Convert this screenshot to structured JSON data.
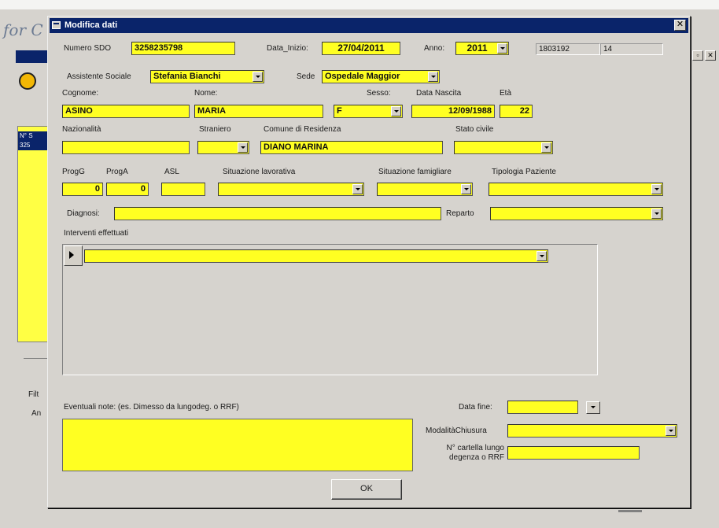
{
  "background_app": {
    "title_partial": "for C",
    "list_header_1": "N° S",
    "list_header_2": "325",
    "label_filter_partial": "Filt",
    "label_an_partial": "An"
  },
  "dialog": {
    "title": "Modifica dati",
    "close_glyph": "✕"
  },
  "fields": {
    "numero_sdo": {
      "label": "Numero SDO",
      "value": "3258235798"
    },
    "data_inizio": {
      "label": "Data_Inizio:",
      "value": "27/04/2011"
    },
    "anno": {
      "label": "Anno:",
      "value": "2011"
    },
    "readonly_1": "1803192",
    "readonly_2": "14",
    "assistente_sociale": {
      "label": "Assistente Sociale",
      "value": "Stefania Bianchi"
    },
    "sede": {
      "label": "Sede",
      "value": "Ospedale Maggior"
    },
    "cognome": {
      "label": "Cognome:",
      "value": "ASINO"
    },
    "nome": {
      "label": "Nome:",
      "value": "MARIA"
    },
    "sesso": {
      "label": "Sesso:",
      "value": "F"
    },
    "data_nascita": {
      "label": "Data Nascita",
      "value": "12/09/1988"
    },
    "eta": {
      "label": "Età",
      "value": "22"
    },
    "nazionalita": {
      "label": "Nazionalità",
      "value": ""
    },
    "straniero": {
      "label": "Straniero",
      "value": ""
    },
    "comune_residenza": {
      "label": "Comune di Residenza",
      "value": "DIANO MARINA"
    },
    "stato_civile": {
      "label": "Stato civile",
      "value": ""
    },
    "prog_g": {
      "label": "ProgG",
      "value": "0"
    },
    "prog_a": {
      "label": "ProgA",
      "value": "0"
    },
    "asl": {
      "label": "ASL",
      "value": ""
    },
    "situazione_lavorativa": {
      "label": "Situazione lavorativa",
      "value": ""
    },
    "situazione_famigliare": {
      "label": "Situazione famigliare",
      "value": ""
    },
    "tipologia_paziente": {
      "label": "Tipologia Paziente",
      "value": ""
    },
    "diagnosi": {
      "label": "Diagnosi:",
      "value": ""
    },
    "reparto": {
      "label": "Reparto",
      "value": ""
    },
    "interventi": {
      "label": "Interventi effettuati",
      "value": ""
    },
    "note": {
      "label": "Eventuali note: (es. Dimesso da lungodeg. o RRF)",
      "value": ""
    },
    "data_fine": {
      "label": "Data fine:",
      "value": ""
    },
    "modalita_chiusura": {
      "label": "ModalitàChiusura",
      "value": ""
    },
    "cartella_line1": "N° cartella lungo",
    "cartella_line2": "degenza o RRF",
    "cartella_value": ""
  },
  "buttons": {
    "ok": "OK"
  },
  "colors": {
    "field_yellow": "#ffff22",
    "title_blue": "#0a246a",
    "face_gray": "#d6d3ce"
  }
}
